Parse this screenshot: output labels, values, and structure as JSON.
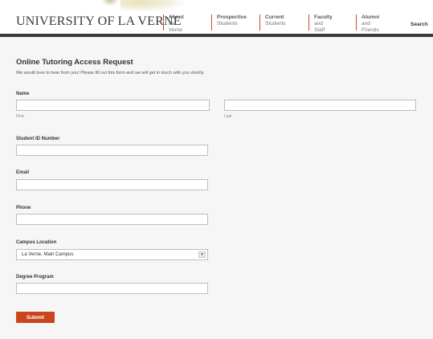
{
  "header": {
    "logo": "UNIVERSITY OF LA VERNE",
    "nav": [
      {
        "line1": "About",
        "line2": "La Verne"
      },
      {
        "line1": "Prospective",
        "line2": "Students"
      },
      {
        "line1": "Current",
        "line2": "Students"
      },
      {
        "line1": "Faculty",
        "line2": "and Staff"
      },
      {
        "line1": "Alumni",
        "line2": "and Friends"
      }
    ],
    "search_label": "Search",
    "accent_color": "#c6472a"
  },
  "form": {
    "title": "Online Tutoring Access Request",
    "subtitle": "We would love to hear from you! Please fill out this form and we will get in touch with you shortly.",
    "name_label": "Name",
    "first_sublabel": "First",
    "last_sublabel": "Last",
    "student_id_label": "Student ID Number",
    "email_label": "Email",
    "phone_label": "Phone",
    "campus_label": "Campus Location",
    "campus_value": "La Verne, Main Campus",
    "degree_label": "Degree Program",
    "submit_label": "Submit",
    "submit_color": "#c8461c"
  }
}
